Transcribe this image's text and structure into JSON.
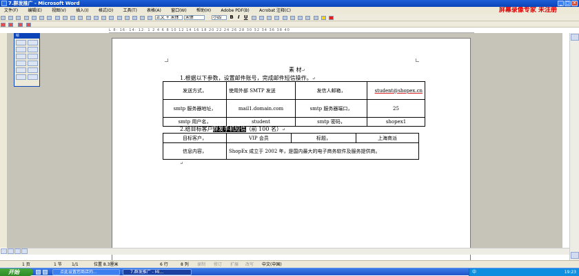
{
  "window": {
    "title": "7.群发推广 - Microsoft Word",
    "promo": "屏幕录像专家 未注册"
  },
  "menu": [
    "文件(F)",
    "编辑(E)",
    "视图(V)",
    "插入(I)",
    "格式(O)",
    "工具(T)",
    "表格(A)",
    "窗口(W)",
    "帮助(H)",
    "Adobe PDF(B)",
    "Acrobat 注释(C)"
  ],
  "toolbar": {
    "style": "正文 + 宋体",
    "font": "宋体",
    "size": "小四",
    "bold": "B",
    "italic": "I",
    "underline": "U"
  },
  "ruler": {
    "ticks": "L 8· 16· 14· 12· 1 2 4 6 8 10 12 14 16 18 20 22 24 26 28 30 32 34 36 38 40"
  },
  "palette": {
    "title": "绘"
  },
  "doc": {
    "heading": "素 材",
    "line1": "1.根据以下参数，设置邮件账号，完成邮件短信操作。",
    "table1": [
      [
        "发送方式，",
        "使用外部 SMTP 发送",
        "发信人邮箱，",
        "student@shopex.cn"
      ],
      [
        "smtp 服务器地址，",
        "mail1.domain.com",
        "smtp 服务器端口，",
        "25"
      ],
      [
        "smtp 用户名，",
        "student",
        "smtp 密码，",
        "shopex1"
      ]
    ],
    "line2_prefix": "2.给目标客户",
    "line2_highlight": "群发手机短信",
    "line2_suffix": "（前 100 名）",
    "table2": {
      "r1": [
        "目标客户，",
        "VIP 会员",
        "标题，",
        "上海商派"
      ],
      "label": "信息内容，",
      "content": "ShopEx 成立于 2002 年，是国内最大的电子商务软件及服务提供商。"
    },
    "para_mark": "↵"
  },
  "status": {
    "page": "1 页",
    "section": "1 节",
    "pages": "1/1",
    "pos": "位置 8.3厘米",
    "line": "6 行",
    "col": "8 列",
    "rec": "录制",
    "trk": "修订",
    "ext": "扩展",
    "ovr": "改写",
    "lang": "中文(中国)"
  },
  "taskbar": {
    "start": "开始",
    "item1": "点此设置您商店的...",
    "item2": "7.群发推广 - Mi...",
    "clock": "19:23",
    "ime": "中"
  }
}
